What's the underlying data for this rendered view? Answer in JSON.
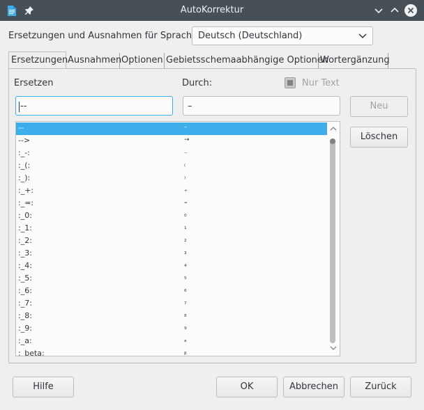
{
  "window": {
    "title": "AutoKorrektur",
    "icons": {
      "app": "document-icon",
      "pin": "pin-icon",
      "minimize": "chevron-down-icon",
      "maximize": "chevron-up-icon",
      "close": "close-icon"
    }
  },
  "language": {
    "label": "Ersetzungen und Ausnahmen für Sprache:",
    "selected": "Deutsch (Deutschland)"
  },
  "tabs": [
    {
      "label": "Ersetzungen",
      "active": true
    },
    {
      "label": "Ausnahmen",
      "active": false
    },
    {
      "label": "Optionen",
      "active": false
    },
    {
      "label": "Gebietsschemaabhängige Optionen",
      "active": false
    },
    {
      "label": "Wortergänzung",
      "active": false
    }
  ],
  "replace": {
    "replace_label": "Ersetzen",
    "with_label": "Durch:",
    "text_only_label": "Nur Text",
    "replace_value": "--",
    "with_value": "–"
  },
  "buttons": {
    "new": "Neu",
    "delete": "Löschen",
    "help": "Hilfe",
    "ok": "OK",
    "cancel": "Abbrechen",
    "reset": "Zurück"
  },
  "entries": [
    {
      "from": "--",
      "to": "–",
      "selected": true
    },
    {
      "from": "-->",
      "to": "→"
    },
    {
      "from": ":_-:",
      "to": "₋"
    },
    {
      "from": ":_(:",
      "to": "₍"
    },
    {
      "from": ":_):",
      "to": "₎"
    },
    {
      "from": ":_+:",
      "to": "₊"
    },
    {
      "from": ":_=:",
      "to": "₌"
    },
    {
      "from": ":_0:",
      "to": "₀"
    },
    {
      "from": ":_1:",
      "to": "₁"
    },
    {
      "from": ":_2:",
      "to": "₂"
    },
    {
      "from": ":_3:",
      "to": "₃"
    },
    {
      "from": ":_4:",
      "to": "₄"
    },
    {
      "from": ":_5:",
      "to": "₅"
    },
    {
      "from": ":_6:",
      "to": "₆"
    },
    {
      "from": ":_7:",
      "to": "₇"
    },
    {
      "from": ":_8:",
      "to": "₈"
    },
    {
      "from": ":_9:",
      "to": "₉"
    },
    {
      "from": ":_a:",
      "to": "ₐ"
    },
    {
      "from": ":_beta:",
      "to": "ᵦ"
    }
  ],
  "colors": {
    "accent": "#3daee9",
    "titlebar": "#475057"
  }
}
